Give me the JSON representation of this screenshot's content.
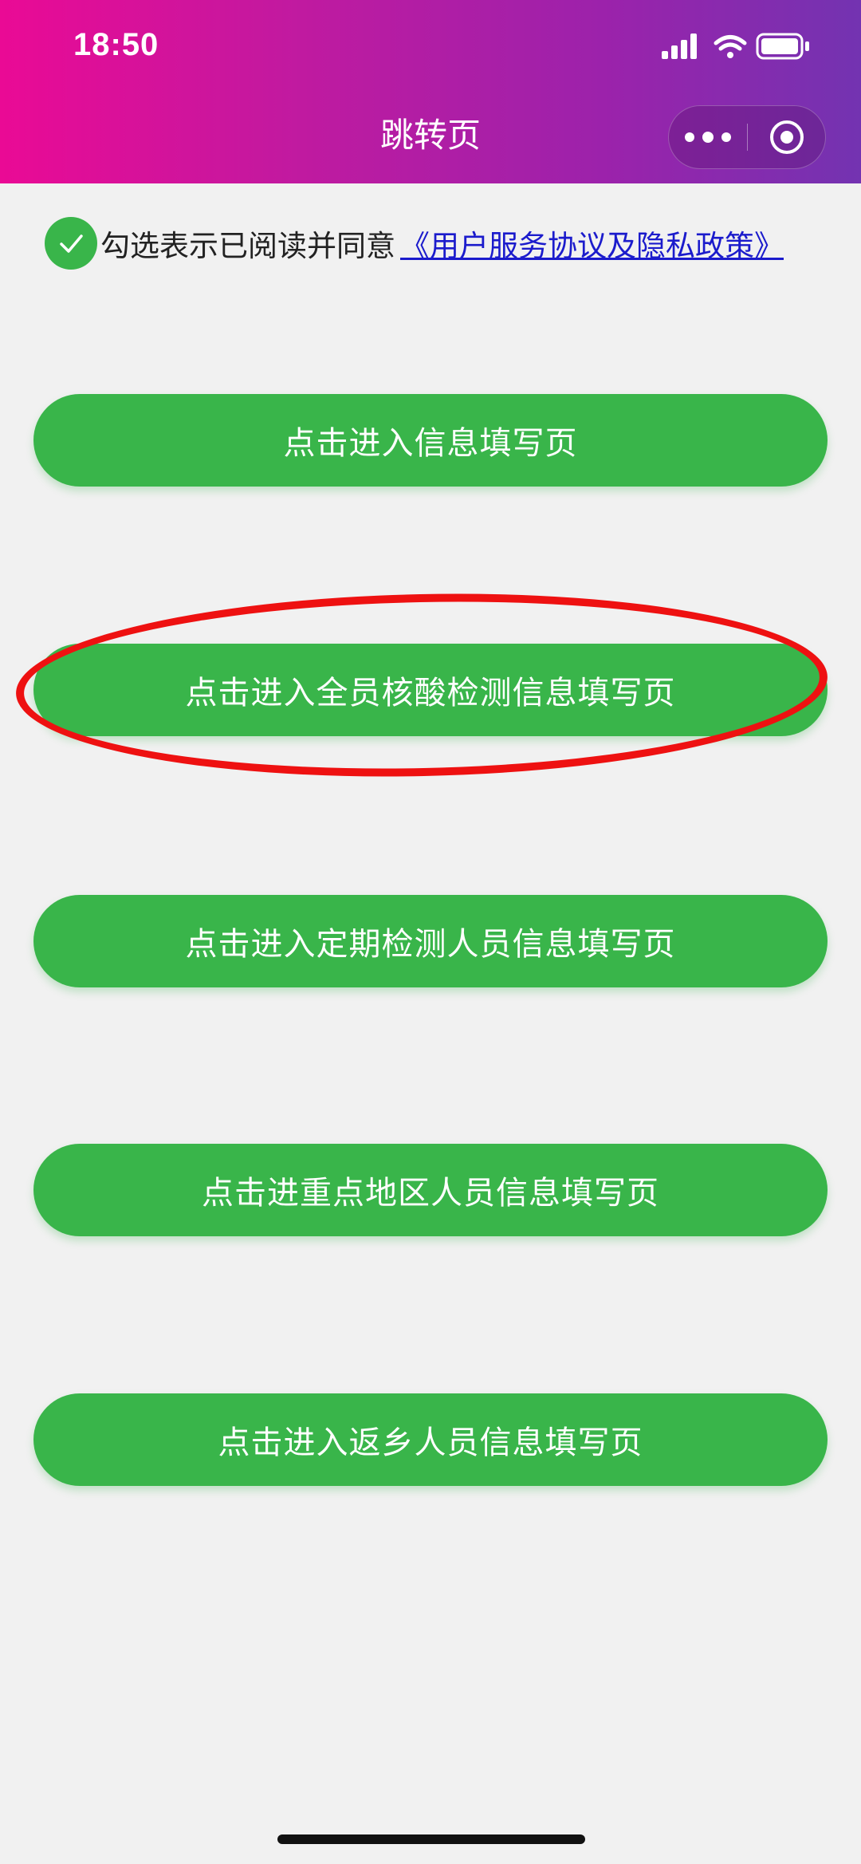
{
  "status_bar": {
    "time": "18:50"
  },
  "header": {
    "title": "跳转页"
  },
  "agreement": {
    "text": "勾选表示已阅读并同意",
    "link": "《用户服务协议及隐私政策》",
    "checked": true
  },
  "buttons": [
    {
      "label": "点击进入信息填写页"
    },
    {
      "label": "点击进入全员核酸检测信息填写页"
    },
    {
      "label": "点击进入定期检测人员信息填写页"
    },
    {
      "label": "点击进重点地区人员信息填写页"
    },
    {
      "label": "点击进入返乡人员信息填写页"
    }
  ],
  "colors": {
    "header_gradient_start": "#ea0a95",
    "header_gradient_end": "#7333b1",
    "button_green": "#39b54a",
    "link_blue": "#1b1bcc",
    "annotation_red": "#ee1111",
    "background": "#f1f1f1"
  },
  "icons": [
    "signal-icon",
    "wifi-icon",
    "battery-icon",
    "more-icon",
    "close-target-icon",
    "check-icon"
  ]
}
